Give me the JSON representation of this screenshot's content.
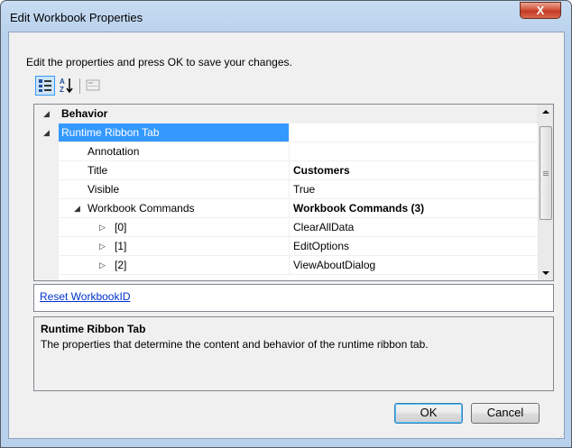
{
  "window": {
    "title": "Edit Workbook Properties",
    "close_glyph": "X"
  },
  "instruction": "Edit the properties and press OK to save your changes.",
  "toolbar": {
    "icons": [
      "categorized-icon",
      "alphabetical-icon",
      "property-pages-icon"
    ]
  },
  "grid": {
    "rows": [
      {
        "kind": "category",
        "name": "Behavior",
        "value": "",
        "expander": "◢",
        "level": 0
      },
      {
        "kind": "category",
        "name": "Runtime Ribbon Tab",
        "value": "",
        "expander": "◢",
        "level": 0,
        "selected": true
      },
      {
        "kind": "prop",
        "name": "Annotation",
        "value": "",
        "expander": "",
        "level": 1
      },
      {
        "kind": "prop",
        "name": "Title",
        "value": "Customers",
        "expander": "",
        "level": 1,
        "bold_value": true
      },
      {
        "kind": "prop",
        "name": "Visible",
        "value": "True",
        "expander": "",
        "level": 1
      },
      {
        "kind": "prop",
        "name": "Workbook Commands",
        "value": "Workbook Commands (3)",
        "expander": "◢",
        "level": 1,
        "bold_value": true
      },
      {
        "kind": "prop",
        "name": "[0]",
        "value": "ClearAllData",
        "expander": "▷",
        "level": 2
      },
      {
        "kind": "prop",
        "name": "[1]",
        "value": "EditOptions",
        "expander": "▷",
        "level": 2
      },
      {
        "kind": "prop",
        "name": "[2]",
        "value": "ViewAboutDialog",
        "expander": "▷",
        "level": 2
      }
    ]
  },
  "commands": {
    "link": "Reset WorkbookID"
  },
  "help": {
    "title": "Runtime Ribbon Tab",
    "description": "The properties that determine the content and behavior of the runtime ribbon tab."
  },
  "buttons": {
    "ok": "OK",
    "cancel": "Cancel"
  },
  "colors": {
    "selection": "#3399ff",
    "link": "#0033cc",
    "frame": "#b9d1ec"
  }
}
